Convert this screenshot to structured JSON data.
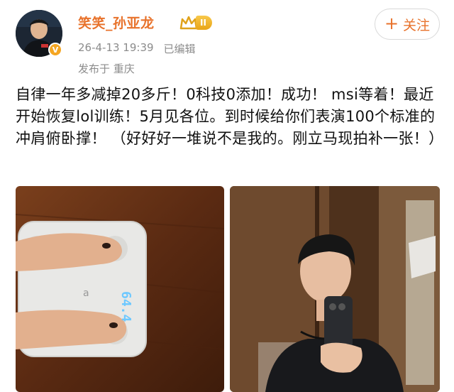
{
  "post": {
    "username": "笑笑_孙亚龙",
    "level_badge": "II",
    "verified_mark": "V",
    "follow_plus": "+",
    "follow_label": "关注",
    "timestamp": "26-4-13 19:39",
    "edited": "已编辑",
    "location": "发布于 重庆",
    "content": "自律一年多减掉20多斤！0科技0添加！成功！ msi等着！最近开始恢复lol训练！5月见各位。到时候给你们表演100个标准的冲肩俯卧撑！ （好好好一堆说不是我的。刚立马现拍补一张！）"
  },
  "photos": {
    "scale_reading": "64.4"
  },
  "colors": {
    "username": "#e8722b",
    "meta": "#8c8c8c",
    "scale_display": "#6ec8ff"
  }
}
